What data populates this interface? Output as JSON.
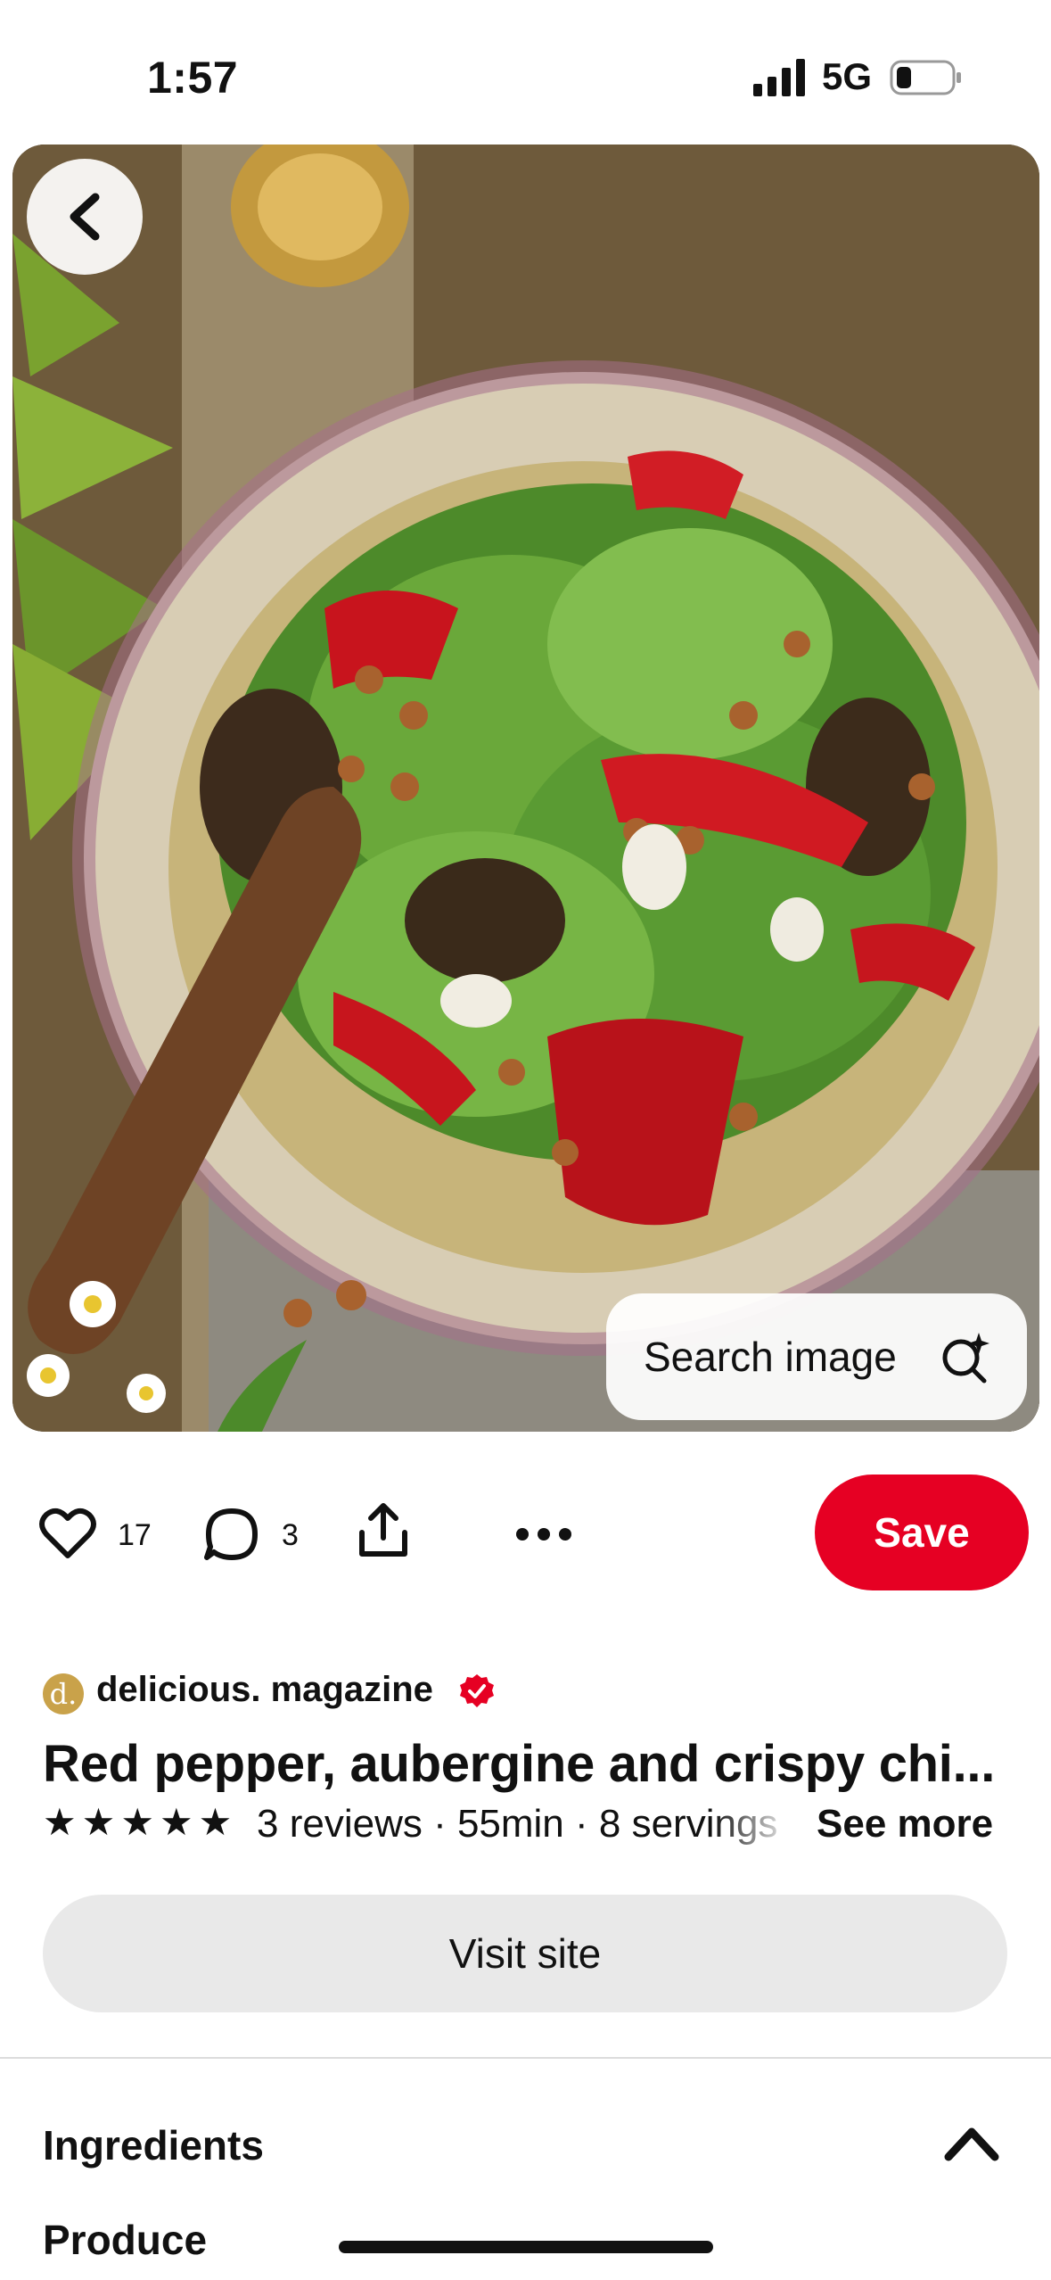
{
  "status_bar": {
    "time": "1:57",
    "network": "5G",
    "signal_icon": "cellular-signal-icon",
    "battery_icon": "battery-low-icon"
  },
  "hero": {
    "back_icon": "chevron-left-icon",
    "search_image_label": "Search image",
    "search_icon": "visual-search-sparkle-icon"
  },
  "actions": {
    "like_icon": "heart-icon",
    "like_count": "17",
    "comment_icon": "comment-bubble-icon",
    "comment_count": "3",
    "share_icon": "share-icon",
    "more_icon": "ellipsis-icon",
    "save_label": "Save",
    "save_color": "#e60023"
  },
  "source": {
    "avatar_letter": "d.",
    "name": "delicious. magazine",
    "verified_icon": "verified-badge-icon",
    "verified_color": "#e60023"
  },
  "pin": {
    "title": "Red pepper, aubergine and crispy chi...",
    "rating_stars": 5,
    "meta": "3 reviews · 55min · 8 servings",
    "see_more_label": "See more",
    "visit_label": "Visit site"
  },
  "ingredients": {
    "heading": "Ingredients",
    "collapse_icon": "chevron-up-icon",
    "first_group": "Produce"
  }
}
